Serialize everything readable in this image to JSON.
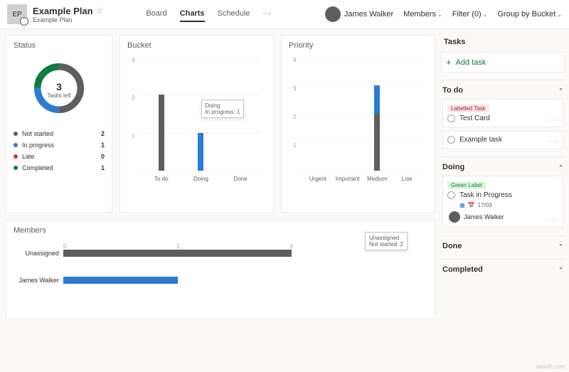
{
  "header": {
    "badge": "EP",
    "title": "Example Plan",
    "subtitle": "Example Plan",
    "tabs": [
      "Board",
      "Charts",
      "Schedule",
      "···"
    ],
    "active_tab": 1,
    "user": "James Walker",
    "controls": {
      "members": "Members",
      "filter": "Filter (0)",
      "group": "Group by Bucket"
    }
  },
  "chart_data": [
    {
      "type": "pie",
      "name": "Status",
      "title": "Status",
      "center_value": "3",
      "center_label": "Tasks left",
      "series": [
        {
          "name": "Not started",
          "value": 2,
          "color": "#605e5c"
        },
        {
          "name": "In progress",
          "value": 1,
          "color": "#2b7cd3"
        },
        {
          "name": "Late",
          "value": 0,
          "color": "#d13438"
        },
        {
          "name": "Completed",
          "value": 1,
          "color": "#107c41"
        }
      ]
    },
    {
      "type": "bar",
      "name": "Bucket",
      "title": "Bucket",
      "categories": [
        "To do",
        "Doing",
        "Done"
      ],
      "ylim": [
        0,
        3
      ],
      "yticks": [
        "3",
        "2",
        "1"
      ],
      "stacks": [
        [
          {
            "name": "Not started",
            "value": 2,
            "color": "#605e5c"
          }
        ],
        [
          {
            "name": "In progress",
            "value": 1,
            "color": "#2b7cd3"
          }
        ],
        []
      ],
      "tooltip": {
        "col": 1,
        "lines": [
          "Doing",
          "In progress: 1"
        ]
      }
    },
    {
      "type": "bar",
      "name": "Priority",
      "title": "Priority",
      "categories": [
        "Urgent",
        "Important",
        "Medium",
        "Low"
      ],
      "ylim": [
        0,
        4
      ],
      "yticks": [
        "4",
        "3",
        "2",
        "1"
      ],
      "stacks": [
        [],
        [],
        [
          {
            "name": "Not started",
            "value": 2,
            "color": "#605e5c"
          },
          {
            "name": "In progress",
            "value": 1,
            "color": "#2b7cd3"
          }
        ],
        []
      ]
    },
    {
      "type": "bar",
      "name": "Members",
      "title": "Members",
      "orientation": "horizontal",
      "categories": [
        "Unassigned",
        "James Walker"
      ],
      "xlim": [
        0,
        3
      ],
      "xticks": [
        "0",
        "1",
        "2",
        "3"
      ],
      "stacks": [
        [
          {
            "name": "Not started",
            "value": 2,
            "color": "#605e5c"
          }
        ],
        [
          {
            "name": "In progress",
            "value": 1,
            "color": "#2b7cd3"
          }
        ]
      ],
      "tooltip": {
        "row": 0,
        "lines": [
          "Unassigned",
          "Not started: 2"
        ]
      }
    }
  ],
  "sidebar": {
    "title": "Tasks",
    "add": "Add task",
    "sections": [
      {
        "name": "To do",
        "tasks": [
          {
            "label": {
              "text": "Labelled Task",
              "bg": "#fde7e9",
              "fg": "#a4262c"
            },
            "title": "Test Card"
          },
          {
            "title": "Example task"
          }
        ]
      },
      {
        "name": "Doing",
        "tasks": [
          {
            "label": {
              "text": "Green Label",
              "bg": "#dff6dd",
              "fg": "#107c41"
            },
            "title": "Task in Progress",
            "date": "17/03",
            "assignee": "James Walker"
          }
        ]
      },
      {
        "name": "Done",
        "tasks": []
      },
      {
        "name": "Completed",
        "tasks": []
      }
    ]
  },
  "watermark": "wsxdn.com"
}
